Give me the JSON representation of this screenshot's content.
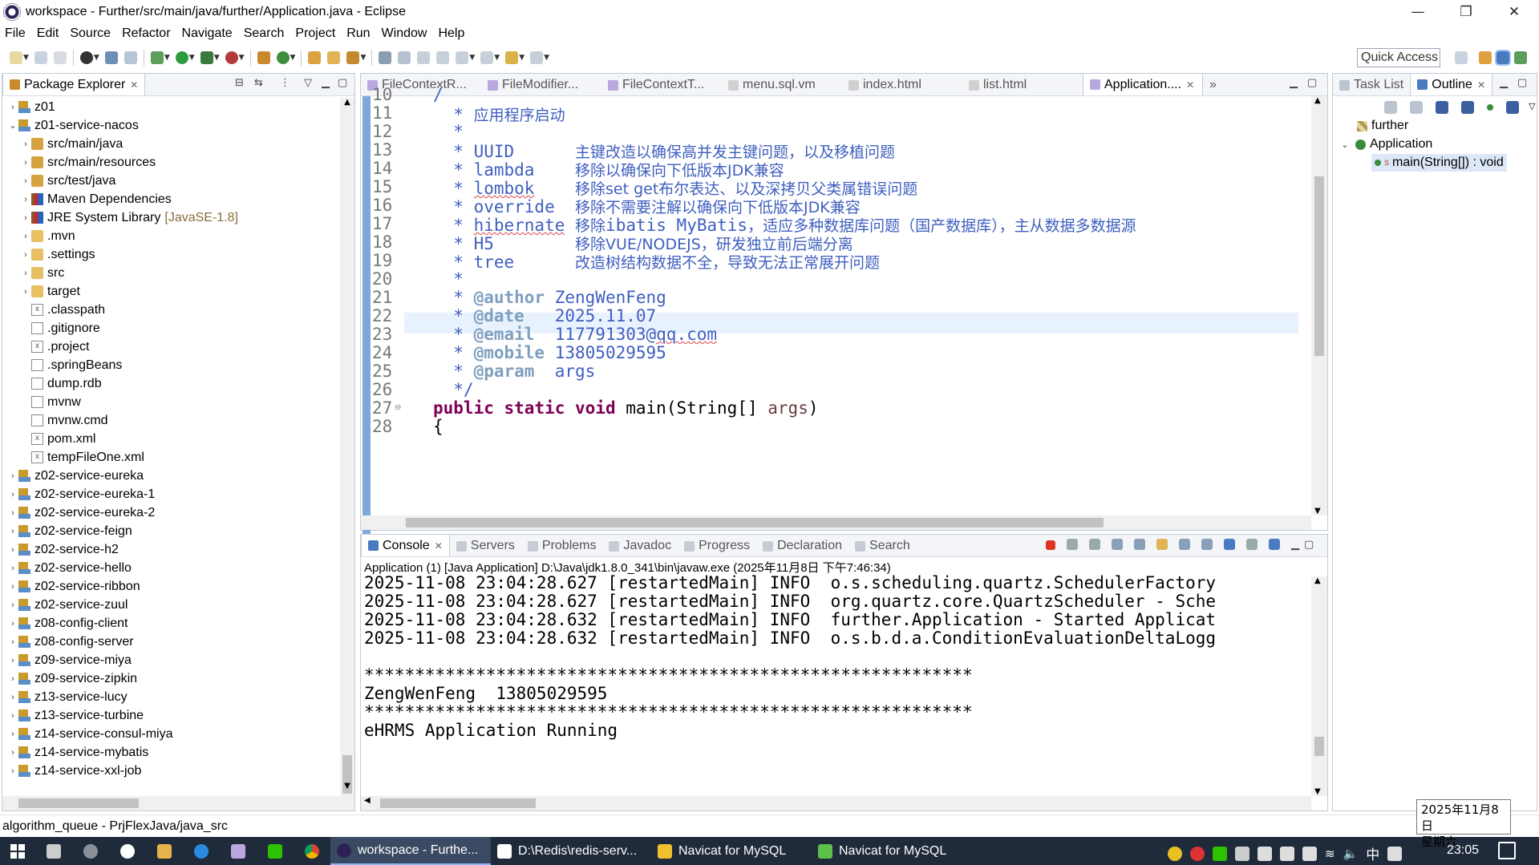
{
  "window": {
    "title": "workspace - Further/src/main/java/further/Application.java - Eclipse"
  },
  "menu": [
    "File",
    "Edit",
    "Source",
    "Refactor",
    "Navigate",
    "Search",
    "Project",
    "Run",
    "Window",
    "Help"
  ],
  "quick_access": "Quick Access",
  "package_explorer": {
    "tab": "Package Explorer",
    "items": [
      {
        "label": "z01",
        "type": "proj",
        "indent": 0,
        "arrow": "›"
      },
      {
        "label": "z01-service-nacos",
        "type": "proj",
        "indent": 0,
        "arrow": "⌄"
      },
      {
        "label": "src/main/java",
        "type": "srcf",
        "indent": 1,
        "arrow": "›"
      },
      {
        "label": "src/main/resources",
        "type": "srcf",
        "indent": 1,
        "arrow": "›"
      },
      {
        "label": "src/test/java",
        "type": "srcf",
        "indent": 1,
        "arrow": "›"
      },
      {
        "label": "Maven Dependencies",
        "type": "lib",
        "indent": 1,
        "arrow": "›"
      },
      {
        "label": "JRE System Library",
        "extra": "[JavaSE-1.8]",
        "type": "lib",
        "indent": 1,
        "arrow": "›"
      },
      {
        "label": ".mvn",
        "type": "folder",
        "indent": 1,
        "arrow": "›"
      },
      {
        "label": ".settings",
        "type": "folder",
        "indent": 1,
        "arrow": "›"
      },
      {
        "label": "src",
        "type": "folder",
        "indent": 1,
        "arrow": "›"
      },
      {
        "label": "target",
        "type": "folder",
        "indent": 1,
        "arrow": "›"
      },
      {
        "label": ".classpath",
        "type": "x",
        "indent": 1,
        "arrow": ""
      },
      {
        "label": ".gitignore",
        "type": "file",
        "indent": 1,
        "arrow": ""
      },
      {
        "label": ".project",
        "type": "x",
        "indent": 1,
        "arrow": ""
      },
      {
        "label": ".springBeans",
        "type": "file",
        "indent": 1,
        "arrow": ""
      },
      {
        "label": "dump.rdb",
        "type": "file",
        "indent": 1,
        "arrow": ""
      },
      {
        "label": "mvnw",
        "type": "file",
        "indent": 1,
        "arrow": ""
      },
      {
        "label": "mvnw.cmd",
        "type": "file",
        "indent": 1,
        "arrow": ""
      },
      {
        "label": "pom.xml",
        "type": "x",
        "indent": 1,
        "arrow": ""
      },
      {
        "label": "tempFileOne.xml",
        "type": "x",
        "indent": 1,
        "arrow": ""
      },
      {
        "label": "z02-service-eureka",
        "type": "proj",
        "indent": 0,
        "arrow": "›"
      },
      {
        "label": "z02-service-eureka-1",
        "type": "proj",
        "indent": 0,
        "arrow": "›"
      },
      {
        "label": "z02-service-eureka-2",
        "type": "proj",
        "indent": 0,
        "arrow": "›"
      },
      {
        "label": "z02-service-feign",
        "type": "proj",
        "indent": 0,
        "arrow": "›"
      },
      {
        "label": "z02-service-h2",
        "type": "proj",
        "indent": 0,
        "arrow": "›"
      },
      {
        "label": "z02-service-hello",
        "type": "proj",
        "indent": 0,
        "arrow": "›"
      },
      {
        "label": "z02-service-ribbon",
        "type": "proj",
        "indent": 0,
        "arrow": "›"
      },
      {
        "label": "z02-service-zuul",
        "type": "proj",
        "indent": 0,
        "arrow": "›"
      },
      {
        "label": "z08-config-client",
        "type": "proj",
        "indent": 0,
        "arrow": "›"
      },
      {
        "label": "z08-config-server",
        "type": "proj",
        "indent": 0,
        "arrow": "›"
      },
      {
        "label": "z09-service-miya",
        "type": "proj",
        "indent": 0,
        "arrow": "›"
      },
      {
        "label": "z09-service-zipkin",
        "type": "proj",
        "indent": 0,
        "arrow": "›"
      },
      {
        "label": "z13-service-lucy",
        "type": "proj",
        "indent": 0,
        "arrow": "›"
      },
      {
        "label": "z13-service-turbine",
        "type": "proj",
        "indent": 0,
        "arrow": "›"
      },
      {
        "label": "z14-service-consul-miya",
        "type": "proj",
        "indent": 0,
        "arrow": "›"
      },
      {
        "label": "z14-service-mybatis",
        "type": "proj",
        "indent": 0,
        "arrow": "›"
      },
      {
        "label": "z14-service-xxl-job",
        "type": "proj",
        "indent": 0,
        "arrow": "›"
      }
    ]
  },
  "editor": {
    "tabs": [
      "FileContextR...",
      "FileModifier...",
      "FileContextT...",
      "menu.sql.vm",
      "index.html",
      "list.html",
      "Application...."
    ],
    "overflow": "»",
    "lines": [
      {
        "n": "10",
        "html": "<span class='cm'>/</span>"
      },
      {
        "n": "11",
        "html": "<span class='cm'>  * </span><span class='cm-zh'>应用程序启动</span>"
      },
      {
        "n": "12",
        "html": "<span class='cm'>  *</span>"
      },
      {
        "n": "13",
        "html": "<span class='cm'>  * UUID      </span><span class='cm-zh'>主键改造以确保高并发主键问题，以及移植问题</span>"
      },
      {
        "n": "14",
        "html": "<span class='cm'>  * lambda    </span><span class='cm-zh'>移除以确保向下低版本JDK兼容</span>"
      },
      {
        "n": "15",
        "html": "<span class='cm'>  * <span class='squig'>lombok</span>    </span><span class='cm-zh'>移除set get布尔表达、以及深拷贝父类属错误问题</span>"
      },
      {
        "n": "16",
        "html": "<span class='cm'>  * override  </span><span class='cm-zh'>移除不需要注解以确保向下低版本JDK兼容</span>"
      },
      {
        "n": "17",
        "html": "<span class='cm'>  * <span class='squig'>hibernate</span> </span><span class='cm-zh'>移除<span style='font-family:DejaVu Sans Mono,monospace;font-size:21px'>ibatis MyBatis</span>，适应多种数据库问题（国产数据库），主从数据多数据源</span>"
      },
      {
        "n": "18",
        "html": "<span class='cm'>  * H5        </span><span class='cm-zh'>移除VUE/NODEJS，研发独立前后端分离</span>"
      },
      {
        "n": "19",
        "html": "<span class='cm'>  * tree      </span><span class='cm-zh'>改造树结构数据不全，导致无法正常展开问题</span>"
      },
      {
        "n": "20",
        "html": "<span class='cm'>  *</span>"
      },
      {
        "n": "21",
        "html": "<span class='cm'>  * </span><span class='tag'>@author</span><span class='cm'> ZengWenFeng</span>"
      },
      {
        "n": "22",
        "html": "<span class='cm'>  * </span><span class='tag'>@date</span><span class='cm'>   2025.11.07</span>"
      },
      {
        "n": "23",
        "html": "<span class='cm'>  * </span><span class='tag'>@email</span><span class='cm'>  117791303@<span class='squig'>qq.com</span></span>"
      },
      {
        "n": "24",
        "html": "<span class='cm'>  * </span><span class='tag'>@mobile</span><span class='cm'> 13805029595</span>"
      },
      {
        "n": "25",
        "html": "<span class='cm'>  * </span><span class='tag'>@param</span><span class='cm'>  args</span>"
      },
      {
        "n": "26",
        "html": "<span class='cm'>  */</span>"
      },
      {
        "n": "27",
        "html": "<span class='kw'>public</span><span class='plain'> </span><span class='kw'>static</span><span class='plain'> </span><span class='kw'>void</span><span class='plain'> main(String[] </span><span class='param'>args</span><span class='plain'>)</span>"
      },
      {
        "n": "28",
        "html": "<span class='plain'>{</span>"
      }
    ]
  },
  "outline": {
    "tabs": [
      "Task List",
      "Outline"
    ],
    "items": [
      "further",
      "Application",
      "main(String[]) : void"
    ]
  },
  "console": {
    "tabs": [
      "Console",
      "Servers",
      "Problems",
      "Javadoc",
      "Progress",
      "Declaration",
      "Search"
    ],
    "info": "Application (1) [Java Application] D:\\Java\\jdk1.8.0_341\\bin\\javaw.exe (2025年11月8日 下午7:46:34)",
    "lines": [
      "2025-11-08 23:04:28.627 [restartedMain] INFO  o.s.scheduling.quartz.SchedulerFactory",
      "2025-11-08 23:04:28.627 [restartedMain] INFO  org.quartz.core.QuartzScheduler - Sche",
      "2025-11-08 23:04:28.632 [restartedMain] INFO  further.Application - Started Applicat",
      "2025-11-08 23:04:28.632 [restartedMain] INFO  o.s.b.d.a.ConditionEvaluationDeltaLogg",
      "",
      "************************************************************",
      "ZengWenFeng  13805029595",
      "************************************************************",
      "eHRMS Application Running"
    ]
  },
  "status": "algorithm_queue - PrjFlexJava/java_src",
  "taskbar": {
    "apps": [
      "workspace - Furthe...",
      "D:\\Redis\\redis-serv...",
      "Navicat for MySQL",
      "Navicat for MySQL"
    ],
    "time": "23:05",
    "ime": "中",
    "date_popup": [
      "2025年11月8日",
      "星期六"
    ]
  }
}
